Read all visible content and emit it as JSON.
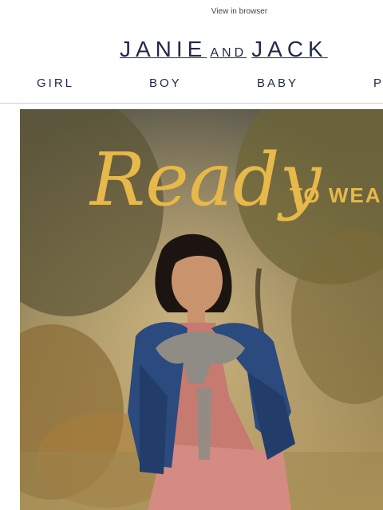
{
  "header": {
    "view_in_browser": "View in browser",
    "brand": {
      "part1": "JANIE",
      "part2": "AND",
      "part3": "JACK"
    }
  },
  "nav": {
    "items": [
      "GIRL",
      "BOY",
      "BABY",
      "P"
    ]
  },
  "hero": {
    "headline_script": "Ready",
    "headline_caps": "TO WEAR",
    "colors": {
      "gold": "#e7b84a",
      "denim": "#2b4a7e",
      "dress": "#c77a70",
      "sweater": "#8f8c86"
    }
  }
}
